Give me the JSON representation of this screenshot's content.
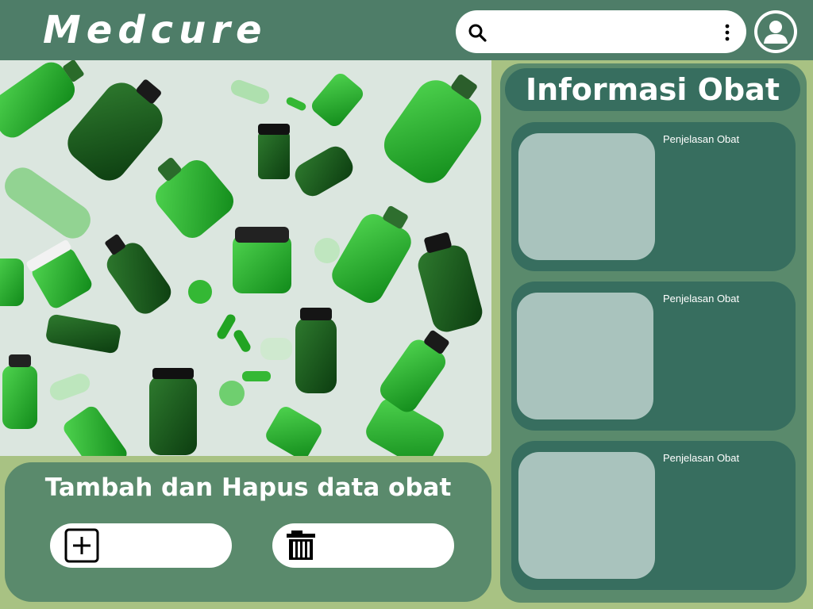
{
  "app": {
    "brand": "Medcure"
  },
  "header": {
    "search": {
      "icon": "search-icon",
      "value": "",
      "placeholder": ""
    },
    "more_icon": "vertical-dots-icon",
    "avatar_icon": "user-icon"
  },
  "hero": {
    "image": "green-medicine-bottles-photo"
  },
  "manage": {
    "title": "Tambah dan Hapus data obat",
    "add_button": {
      "icon": "plus-square-icon",
      "label": ""
    },
    "delete_button": {
      "icon": "trash-icon",
      "label": ""
    }
  },
  "info": {
    "title": "Informasi Obat",
    "cards": [
      {
        "label": "Penjelasan Obat"
      },
      {
        "label": "Penjelasan Obat"
      },
      {
        "label": "Penjelasan Obat"
      }
    ]
  },
  "colors": {
    "page_bg": "#a8c283",
    "header_bg": "#4e7d68",
    "panel_bg": "#5a8a6c",
    "card_bg": "#376e5f",
    "card_image_bg": "#a9c3bd",
    "white": "#ffffff"
  }
}
